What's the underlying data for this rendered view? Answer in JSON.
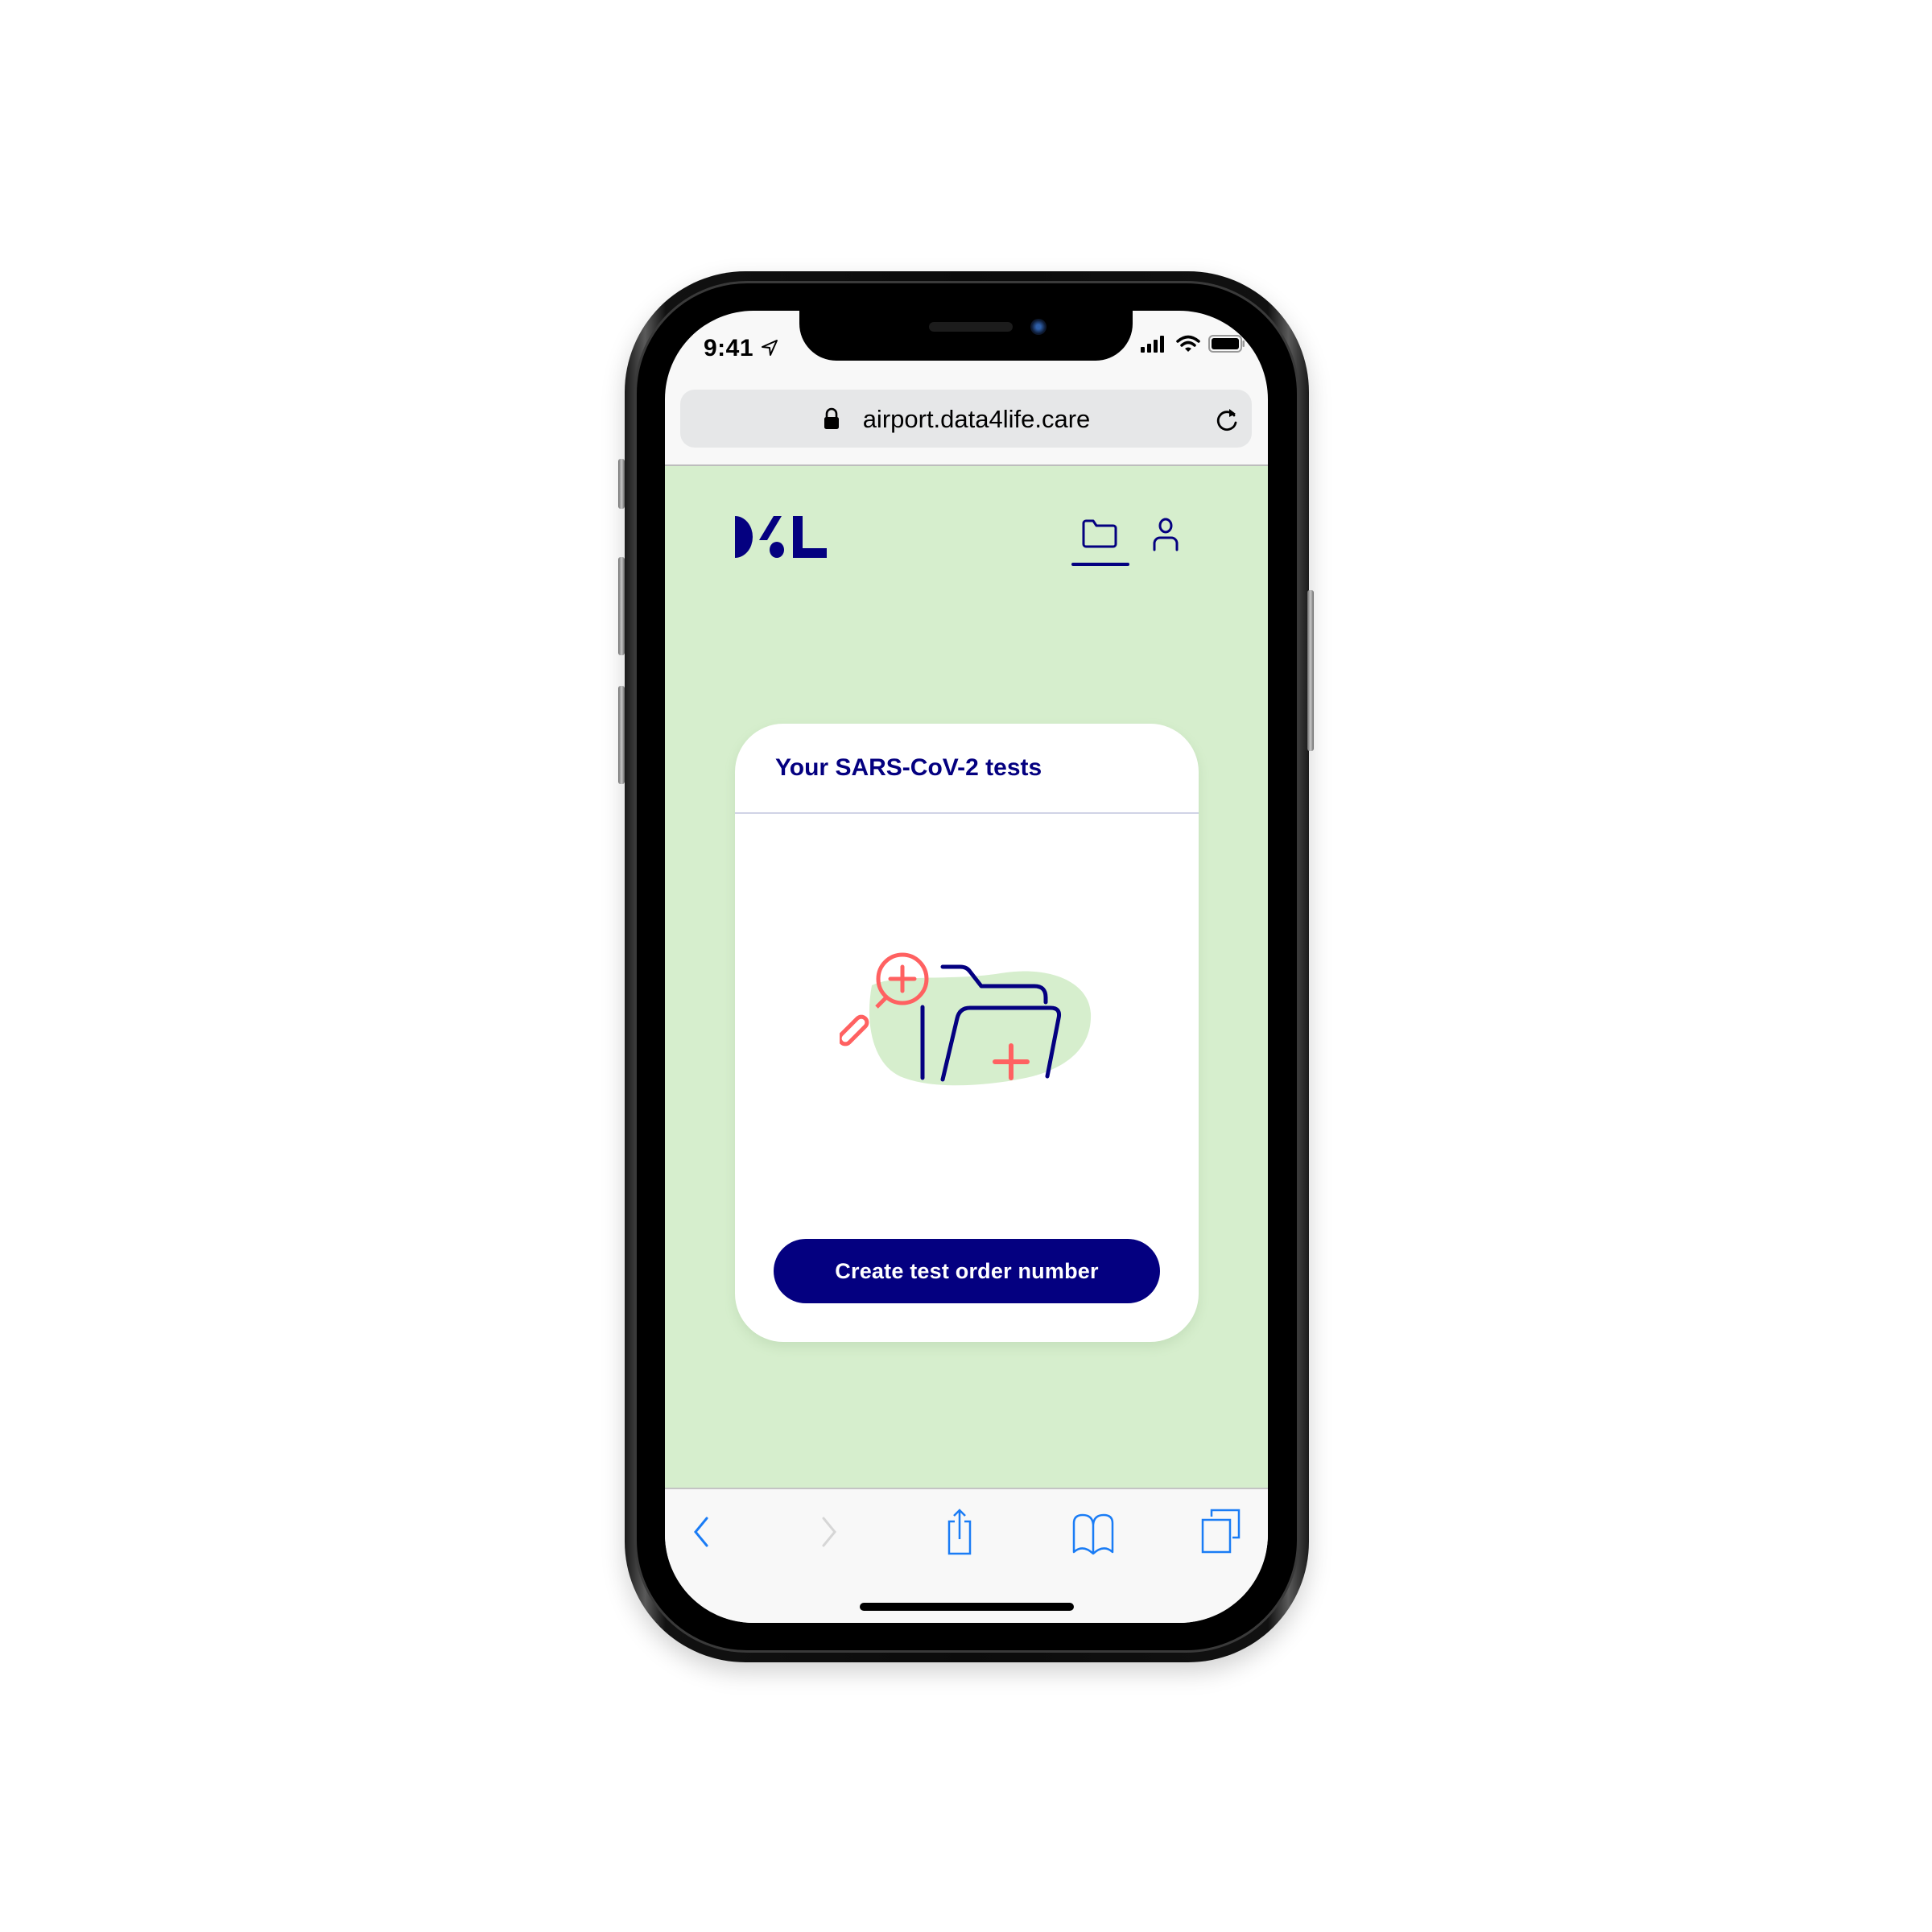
{
  "status_bar": {
    "time": "9:41",
    "icons": [
      "location-arrow-icon",
      "cellular-signal-icon",
      "wifi-icon",
      "battery-icon"
    ]
  },
  "browser": {
    "url": "airport.data4life.care",
    "lock_icon": "lock-icon",
    "reload_icon": "reload-icon"
  },
  "app": {
    "logo_text": "D4L",
    "nav": [
      {
        "name": "records",
        "icon": "folder-icon",
        "active": true
      },
      {
        "name": "profile",
        "icon": "user-icon",
        "active": false
      }
    ],
    "colors": {
      "brand": "#040080",
      "background": "#d6eecd",
      "accent": "#ff6161"
    }
  },
  "card": {
    "title": "Your SARS-CoV-2 tests",
    "illustration": "folder-with-magnifier-illustration",
    "button_label": "Create test order number"
  },
  "toolbar": {
    "items": [
      {
        "name": "back",
        "icon": "chevron-left-icon",
        "enabled": true
      },
      {
        "name": "forward",
        "icon": "chevron-right-icon",
        "enabled": false
      },
      {
        "name": "share",
        "icon": "share-icon",
        "enabled": true
      },
      {
        "name": "bookmarks",
        "icon": "book-icon",
        "enabled": true
      },
      {
        "name": "tabs",
        "icon": "tabs-icon",
        "enabled": true
      }
    ],
    "tint": "#1a7cf5"
  }
}
